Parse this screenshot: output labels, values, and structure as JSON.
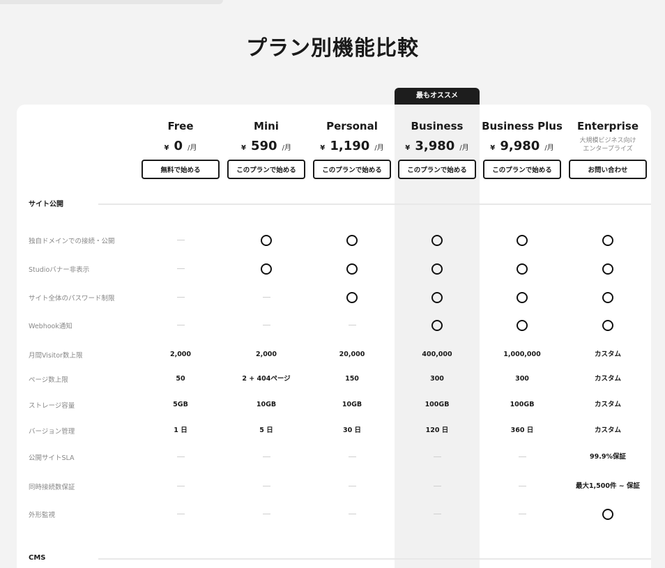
{
  "page": {
    "title": "プラン別機能比較"
  },
  "badge": {
    "label": "最もオススメ"
  },
  "plans": [
    {
      "name": "Free",
      "currency": "¥",
      "price": "0",
      "unit": "/月",
      "button": "無料で始める"
    },
    {
      "name": "Mini",
      "currency": "¥",
      "price": "590",
      "unit": "/月",
      "button": "このプランで始める"
    },
    {
      "name": "Personal",
      "currency": "¥",
      "price": "1,190",
      "unit": "/月",
      "button": "このプランで始める"
    },
    {
      "name": "Business",
      "currency": "¥",
      "price": "3,980",
      "unit": "/月",
      "button": "このプランで始める"
    },
    {
      "name": "Business Plus",
      "currency": "¥",
      "price": "9,980",
      "unit": "/月",
      "button": "このプランで始める"
    },
    {
      "name": "Enterprise",
      "note_line1": "大規模ビジネス向け",
      "note_line2": "エンタープライズ",
      "button": "お問い合わせ"
    }
  ],
  "sections": [
    {
      "title": "サイト公開"
    },
    {
      "title": "CMS"
    }
  ],
  "rows": [
    {
      "label": "独自ドメインでの接続・公開",
      "values": [
        "-",
        "o",
        "o",
        "o",
        "o",
        "o"
      ]
    },
    {
      "label": "Studioバナー非表示",
      "values": [
        "-",
        "o",
        "o",
        "o",
        "o",
        "o"
      ]
    },
    {
      "label": "サイト全体のパスワード制限",
      "values": [
        "-",
        "-",
        "o",
        "o",
        "o",
        "o"
      ]
    },
    {
      "label": "Webhook通知",
      "values": [
        "-",
        "-",
        "-",
        "o",
        "o",
        "o"
      ]
    },
    {
      "label": "月間Visitor数上限",
      "values": [
        "2,000",
        "2,000",
        "20,000",
        "400,000",
        "1,000,000",
        "カスタム"
      ]
    },
    {
      "label": "ページ数上限",
      "values": [
        "50",
        "2 + 404ページ",
        "150",
        "300",
        "300",
        "カスタム"
      ]
    },
    {
      "label": "ストレージ容量",
      "values": [
        "5GB",
        "10GB",
        "10GB",
        "100GB",
        "100GB",
        "カスタム"
      ]
    },
    {
      "label": "バージョン管理",
      "values": [
        "1 日",
        "5 日",
        "30 日",
        "120 日",
        "360 日",
        "カスタム"
      ]
    },
    {
      "label": "公開サイトSLA",
      "values": [
        "-",
        "-",
        "-",
        "-",
        "-",
        "99.9%保証"
      ]
    },
    {
      "label": "同時接続数保証",
      "values": [
        "-",
        "-",
        "-",
        "-",
        "-",
        "最大1,500件 ~ 保証"
      ]
    },
    {
      "label": "外形監視",
      "values": [
        "-",
        "-",
        "-",
        "-",
        "-",
        "o"
      ]
    }
  ],
  "icons": {
    "available": "circle-icon",
    "unavailable": "dash-icon"
  }
}
